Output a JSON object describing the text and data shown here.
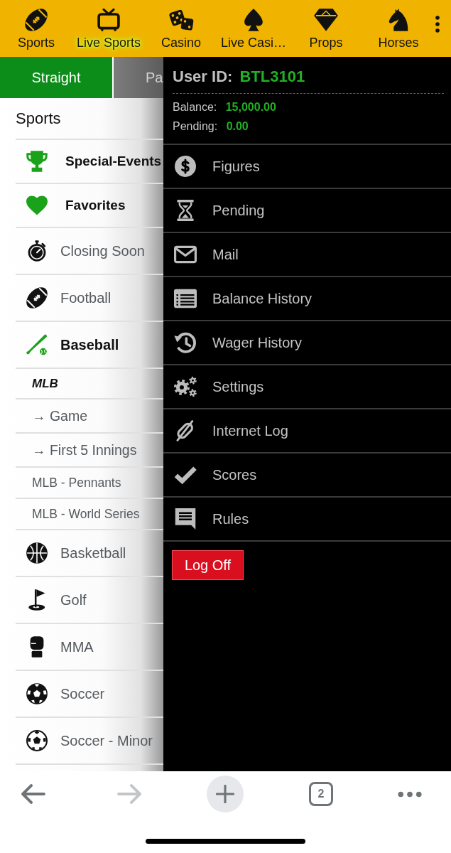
{
  "top_nav": {
    "items": [
      {
        "label": "Sports",
        "selected": false
      },
      {
        "label": "Live Sports",
        "selected": true
      },
      {
        "label": "Casino",
        "selected": false
      },
      {
        "label": "Live Casi…",
        "selected": false
      },
      {
        "label": "Props",
        "selected": false
      },
      {
        "label": "Horses",
        "selected": false
      }
    ]
  },
  "bet_tabs": [
    {
      "label": "Straight",
      "selected": true
    },
    {
      "label": "Pa",
      "selected": false
    }
  ],
  "sports_menu": {
    "title": "Sports",
    "items": [
      {
        "label": "Special-Events",
        "kind": "featured"
      },
      {
        "label": "Favorites",
        "kind": "featured"
      },
      {
        "label": "Closing Soon",
        "kind": "sport",
        "expanded": false
      },
      {
        "label": "Football",
        "kind": "sport",
        "expanded": false
      },
      {
        "label": "Baseball",
        "kind": "sport",
        "expanded": true,
        "children": [
          {
            "label": "MLB",
            "kind": "league",
            "children": [
              {
                "label": "→ Game"
              },
              {
                "label": "→ First 5 Innings"
              }
            ]
          },
          {
            "label": "MLB - Pennants",
            "kind": "market"
          },
          {
            "label": "MLB - World Series",
            "kind": "market"
          }
        ]
      },
      {
        "label": "Basketball",
        "kind": "sport",
        "expanded": false
      },
      {
        "label": "Golf",
        "kind": "sport",
        "expanded": false
      },
      {
        "label": "MMA",
        "kind": "sport",
        "expanded": false
      },
      {
        "label": "Soccer",
        "kind": "sport",
        "expanded": false
      },
      {
        "label": "Soccer - Minor",
        "kind": "sport",
        "expanded": false
      }
    ]
  },
  "account_drawer": {
    "user_id_label": "User ID:",
    "user_id": "BTL3101",
    "balance_label": "Balance:",
    "balance": "15,000.00",
    "pending_label": "Pending:",
    "pending": "0.00",
    "menu": [
      {
        "label": "Figures"
      },
      {
        "label": "Pending"
      },
      {
        "label": "Mail"
      },
      {
        "label": "Balance History"
      },
      {
        "label": "Wager History"
      },
      {
        "label": "Settings"
      },
      {
        "label": "Internet Log"
      },
      {
        "label": "Scores"
      },
      {
        "label": "Rules"
      }
    ],
    "log_off_button": "Log Off"
  },
  "browser_toolbar": {
    "back": {
      "disabled": false
    },
    "forward": {
      "disabled": true
    },
    "tab_count": "2"
  }
}
